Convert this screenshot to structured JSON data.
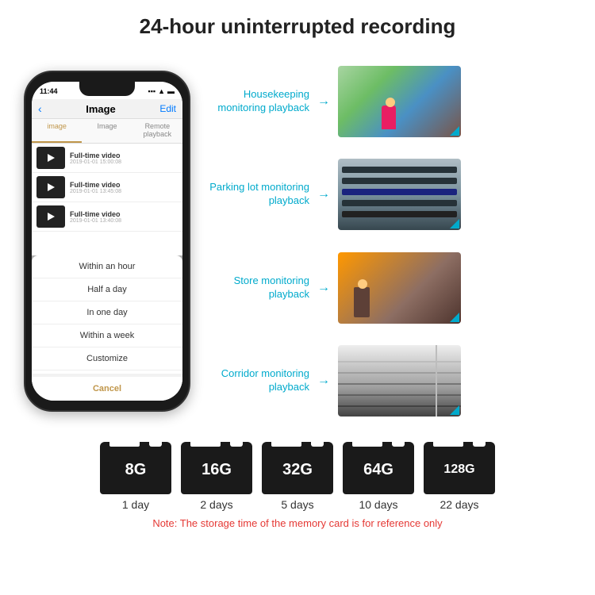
{
  "header": {
    "title": "24-hour uninterrupted recording"
  },
  "phone": {
    "time": "11:44",
    "app_title": "Image",
    "back_label": "‹",
    "edit_label": "Edit",
    "tabs": [
      "image",
      "Image",
      "Remote playback"
    ],
    "videos": [
      {
        "title": "Full-time video",
        "date": "2019-01-01 15:00:08"
      },
      {
        "title": "Full-time video",
        "date": "2019-01-01 13:45:08"
      },
      {
        "title": "Full-time video",
        "date": "2019-01-01 13:40:08"
      }
    ],
    "dropdown_items": [
      "Within an hour",
      "Half a day",
      "In one day",
      "Within a week",
      "Customize"
    ],
    "cancel_label": "Cancel"
  },
  "monitoring": [
    {
      "label": "Housekeeping monitoring playback",
      "scene": "housekeeping"
    },
    {
      "label": "Parking lot monitoring playback",
      "scene": "parking"
    },
    {
      "label": "Store monitoring playback",
      "scene": "store"
    },
    {
      "label": "Corridor monitoring playback",
      "scene": "corridor"
    }
  ],
  "storage": {
    "cards": [
      {
        "size": "8G",
        "days": "1 day"
      },
      {
        "size": "16G",
        "days": "2 days"
      },
      {
        "size": "32G",
        "days": "5 days"
      },
      {
        "size": "64G",
        "days": "10 days"
      },
      {
        "size": "128G",
        "days": "22 days"
      }
    ],
    "note": "Note: The storage time of the memory card is for reference only"
  }
}
